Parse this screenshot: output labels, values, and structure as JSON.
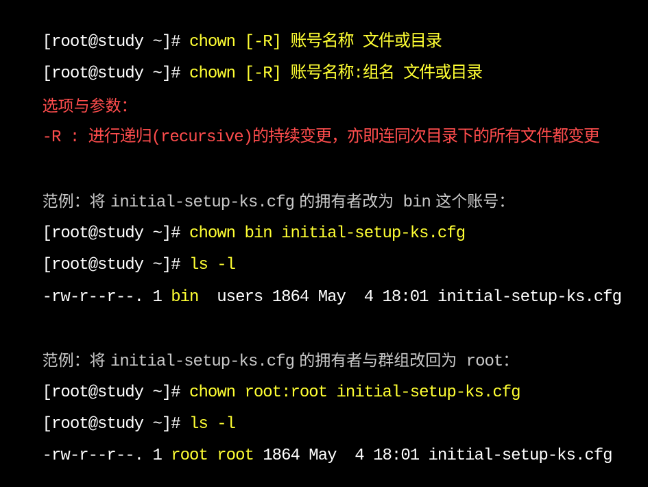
{
  "lines": [
    {
      "prompt": "[root@study ~]# ",
      "command": "chown [-R] 账号名称 文件或目录"
    },
    {
      "prompt": "[root@study ~]# ",
      "command": "chown [-R] 账号名称:组名 文件或目录"
    },
    {
      "heading": "选项与参数："
    },
    {
      "option": "-R : 进行递归(recursive)的持续变更，亦即连同次目录下的所有文件都变更"
    },
    {
      "blank": ""
    },
    {
      "example_prefix": "范例：将 ",
      "example_file": "initial-setup-ks.cfg",
      "example_mid": " 的拥有者改为",
      "example_target": " bin",
      "example_suffix": " 这个账号："
    },
    {
      "prompt": "[root@study ~]# ",
      "command": "chown bin initial-setup-ks.cfg"
    },
    {
      "prompt": "[root@study ~]# ",
      "command": "ls -l"
    },
    {
      "ls_perm": "-rw-r--r--. 1 ",
      "ls_owner": "bin",
      "ls_gap": "  ",
      "ls_group": "users",
      "ls_rest": " 1864 May  4 18:01 initial-setup-ks.cfg"
    },
    {
      "blank": ""
    },
    {
      "example_prefix": "范例：将 ",
      "example_file": "initial-setup-ks.cfg",
      "example_mid": " 的拥有者与群组改回为",
      "example_target": " root",
      "example_suffix": "："
    },
    {
      "prompt": "[root@study ~]# ",
      "command": "chown root:root initial-setup-ks.cfg"
    },
    {
      "prompt": "[root@study ~]# ",
      "command": "ls -l"
    },
    {
      "ls_perm": "-rw-r--r--. 1 ",
      "ls_owner": "root",
      "ls_gap": " ",
      "ls_group": "root",
      "ls_rest": " 1864 May  4 18:01 initial-setup-ks.cfg"
    }
  ],
  "colors": {
    "background": "#000000",
    "prompt": "#ffffff",
    "command": "#ffff33",
    "option": "#ff4d4d",
    "example": "#c8c8c8"
  }
}
